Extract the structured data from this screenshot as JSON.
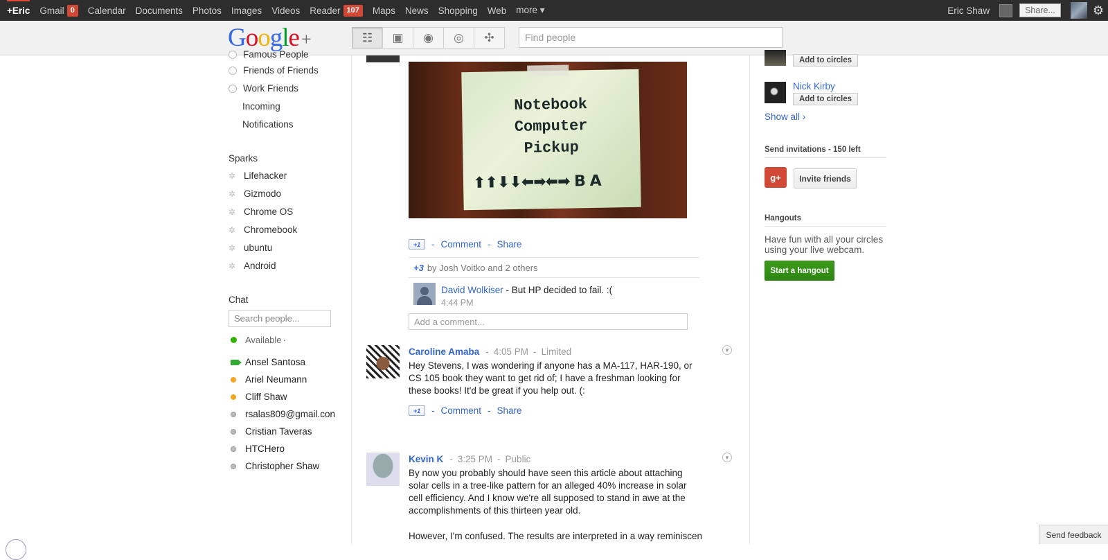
{
  "topbar": {
    "items": [
      {
        "label": "+Eric"
      },
      {
        "label": "Gmail",
        "badge": "0"
      },
      {
        "label": "Calendar"
      },
      {
        "label": "Documents"
      },
      {
        "label": "Photos"
      },
      {
        "label": "Images"
      },
      {
        "label": "Videos"
      },
      {
        "label": "Reader",
        "badge": "107"
      },
      {
        "label": "Maps"
      },
      {
        "label": "News"
      },
      {
        "label": "Shopping"
      },
      {
        "label": "Web"
      },
      {
        "label": "more ▾"
      }
    ],
    "user_name": "Eric Shaw",
    "share_label": "Share..."
  },
  "header": {
    "logo_text": "Google+",
    "find_people_placeholder": "Find people",
    "nav_icons": [
      "home-icon",
      "photos-icon",
      "profile-icon",
      "circles-icon",
      "games-icon"
    ]
  },
  "left": {
    "circles": [
      {
        "label": "Famous People"
      },
      {
        "label": "Friends of Friends"
      },
      {
        "label": "Work Friends"
      }
    ],
    "sub_items": [
      "Incoming",
      "Notifications"
    ],
    "sparks_heading": "Sparks",
    "sparks": [
      "Lifehacker",
      "Gizmodo",
      "Chrome OS",
      "Chromebook",
      "ubuntu",
      "Android"
    ],
    "chat_heading": "Chat",
    "chat_search_placeholder": "Search people...",
    "status_label": "Available",
    "contacts": [
      {
        "name": "Ansel Santosa",
        "status": "video"
      },
      {
        "name": "Ariel Neumann",
        "status": "idle"
      },
      {
        "name": "Cliff Shaw",
        "status": "idle"
      },
      {
        "name": "rsalas809@gmail.con",
        "status": "offline"
      },
      {
        "name": "Cristian Taveras",
        "status": "offline"
      },
      {
        "name": "HTCHero",
        "status": "offline"
      },
      {
        "name": "Christopher Shaw",
        "status": "offline"
      }
    ]
  },
  "stream": {
    "photo_text": {
      "line1": "Notebook",
      "line2": "Computer",
      "line3": "Pickup",
      "code": "⬆⬆⬇⬇⬅➡⬅➡ B A"
    },
    "post1_actions": {
      "plus_one": "+1",
      "comment": "Comment",
      "share": "Share"
    },
    "plus_summary": {
      "count": "+3",
      "text": "by Josh Voitko and 2 others"
    },
    "comment": {
      "author": "David Wolkiser",
      "text": " - But HP decided to fail. :(",
      "time": "4:44 PM"
    },
    "add_comment_placeholder": "Add a comment...",
    "posts": [
      {
        "author": "Caroline Amaba",
        "time": "4:05 PM",
        "visibility": "Limited",
        "body": "Hey Stevens, I was wondering if anyone has a MA-117, HAR-190, or CS 105 book they want to get rid of; I have a freshman looking for these books! It'd be great if you help out. (:",
        "actions": {
          "plus_one": "+1",
          "comment": "Comment",
          "share": "Share"
        }
      },
      {
        "author": "Kevin K",
        "time": "3:25 PM",
        "visibility": "Public",
        "body": "By now you probably should have seen this article about attaching solar cells in a tree-like pattern for an alleged 40% increase in solar cell efficiency. And I know we're all supposed to stand in awe at the accomplishments of this thirteen year old.",
        "body2": "However, I'm confused. The results are interpreted in a way reminiscent of"
      }
    ]
  },
  "right": {
    "suggestions": [
      {
        "name": "",
        "button": "Add to circles"
      },
      {
        "name": "Nick Kirby",
        "button": "Add to circles"
      }
    ],
    "show_all": "Show all ›",
    "invites_heading": "Send invitations - 150 left",
    "gmail_badge": "g+",
    "invite_button": "Invite friends",
    "hangouts_heading": "Hangouts",
    "hangouts_text": "Have fun with all your circles using your live webcam.",
    "hangout_button": "Start a hangout"
  },
  "footer": {
    "feedback": "Send feedback"
  },
  "colors": {
    "topbar_bg": "#2d2d2d",
    "link": "#3366cc",
    "badge": "#d14836",
    "hangout_green": "#2d8612"
  }
}
